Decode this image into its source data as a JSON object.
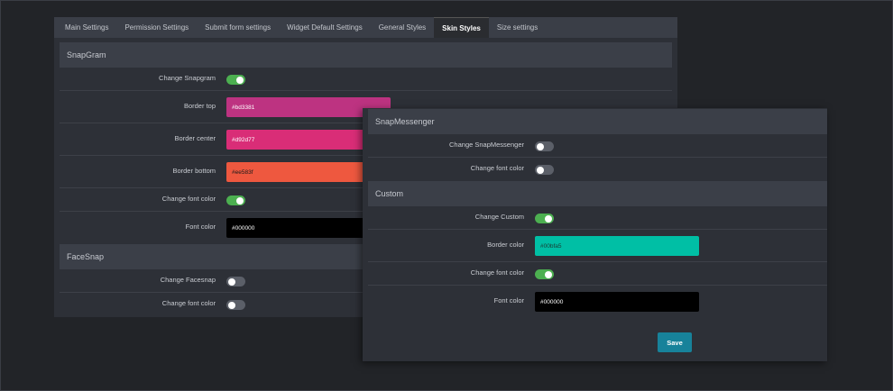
{
  "tabs": [
    {
      "label": "Main Settings"
    },
    {
      "label": "Permission Settings"
    },
    {
      "label": "Submit form settings"
    },
    {
      "label": "Widget Default Settings"
    },
    {
      "label": "General Styles"
    },
    {
      "label": "Skin Styles",
      "active": true
    },
    {
      "label": "Size settings"
    }
  ],
  "snapgram": {
    "title": "SnapGram",
    "change_label": "Change Snapgram",
    "border_top_label": "Border top",
    "border_top_value": "#bd3381",
    "border_center_label": "Border center",
    "border_center_value": "#d92d77",
    "border_bottom_label": "Border bottom",
    "border_bottom_value": "#ee583f",
    "change_font_color_label": "Change font color",
    "font_color_label": "Font color",
    "font_color_value": "#000000"
  },
  "facesnap": {
    "title": "FaceSnap",
    "change_label": "Change Facesnap",
    "change_font_color_label": "Change font color"
  },
  "snapmessenger": {
    "title": "SnapMessenger",
    "change_label": "Change SnapMessenger",
    "change_font_color_label": "Change font color"
  },
  "custom": {
    "title": "Custom",
    "change_label": "Change Custom",
    "border_color_label": "Border color",
    "border_color_value": "#00bfa5",
    "change_font_color_label": "Change font color",
    "font_color_label": "Font color",
    "font_color_value": "#000000"
  },
  "save_label": "Save",
  "colors": {
    "toggle_on": "#4caf50",
    "toggle_off": "#5b5f68",
    "save_button": "#17829a"
  }
}
